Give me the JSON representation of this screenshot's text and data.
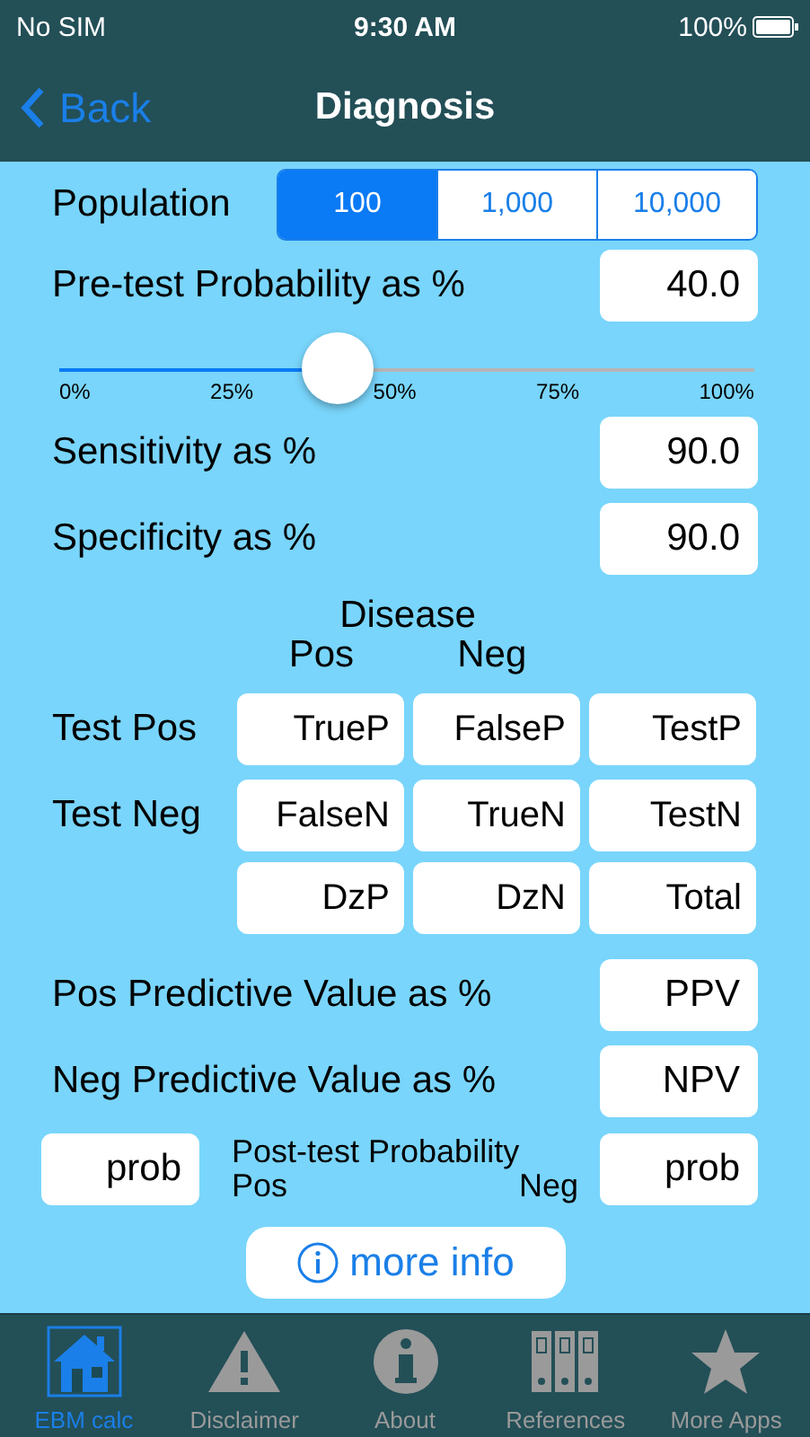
{
  "status_bar": {
    "carrier": "No SIM",
    "time": "9:30 AM",
    "battery": "100%"
  },
  "nav": {
    "back": "Back",
    "title": "Diagnosis"
  },
  "population": {
    "label": "Population",
    "options": [
      {
        "label": "100",
        "selected": true
      },
      {
        "label": "1,000",
        "selected": false
      },
      {
        "label": "10,000",
        "selected": false
      }
    ]
  },
  "pretest": {
    "label": "Pre-test Probability as %",
    "value": "40.0"
  },
  "slider": {
    "level": 0.4,
    "ticks": [
      "0%",
      "25%",
      "50%",
      "75%",
      "100%"
    ]
  },
  "inputs": [
    {
      "label": "Sensitivity as %",
      "value": "90.0"
    },
    {
      "label": "Specificity as %",
      "value": "90.0"
    }
  ],
  "table": {
    "heading": "Disease",
    "columns": [
      "Pos",
      "Neg"
    ],
    "rows": [
      {
        "label": "Test Pos",
        "cells": [
          "TrueP",
          "FalseP",
          "TestP"
        ]
      },
      {
        "label": "Test Neg",
        "cells": [
          "FalseN",
          "TrueN",
          "TestN"
        ]
      },
      {
        "cells": [
          "DzP",
          "DzN",
          "Total"
        ]
      }
    ]
  },
  "results": [
    {
      "label": "Pos Predictive Value as %",
      "value": "PPV"
    },
    {
      "label": "Neg Predictive Value as %",
      "value": "NPV"
    }
  ],
  "post_test": {
    "pos_value": "prob",
    "title": "Post-test Probability",
    "pos_label": "Pos",
    "neg_label": "Neg",
    "neg_value": "prob"
  },
  "more_info": "more info",
  "tabs": [
    {
      "label": "EBM calc",
      "selected": true
    },
    {
      "label": "Disclaimer",
      "selected": false
    },
    {
      "label": "About",
      "selected": false
    },
    {
      "label": "References",
      "selected": false
    },
    {
      "label": "More Apps",
      "selected": false
    }
  ]
}
